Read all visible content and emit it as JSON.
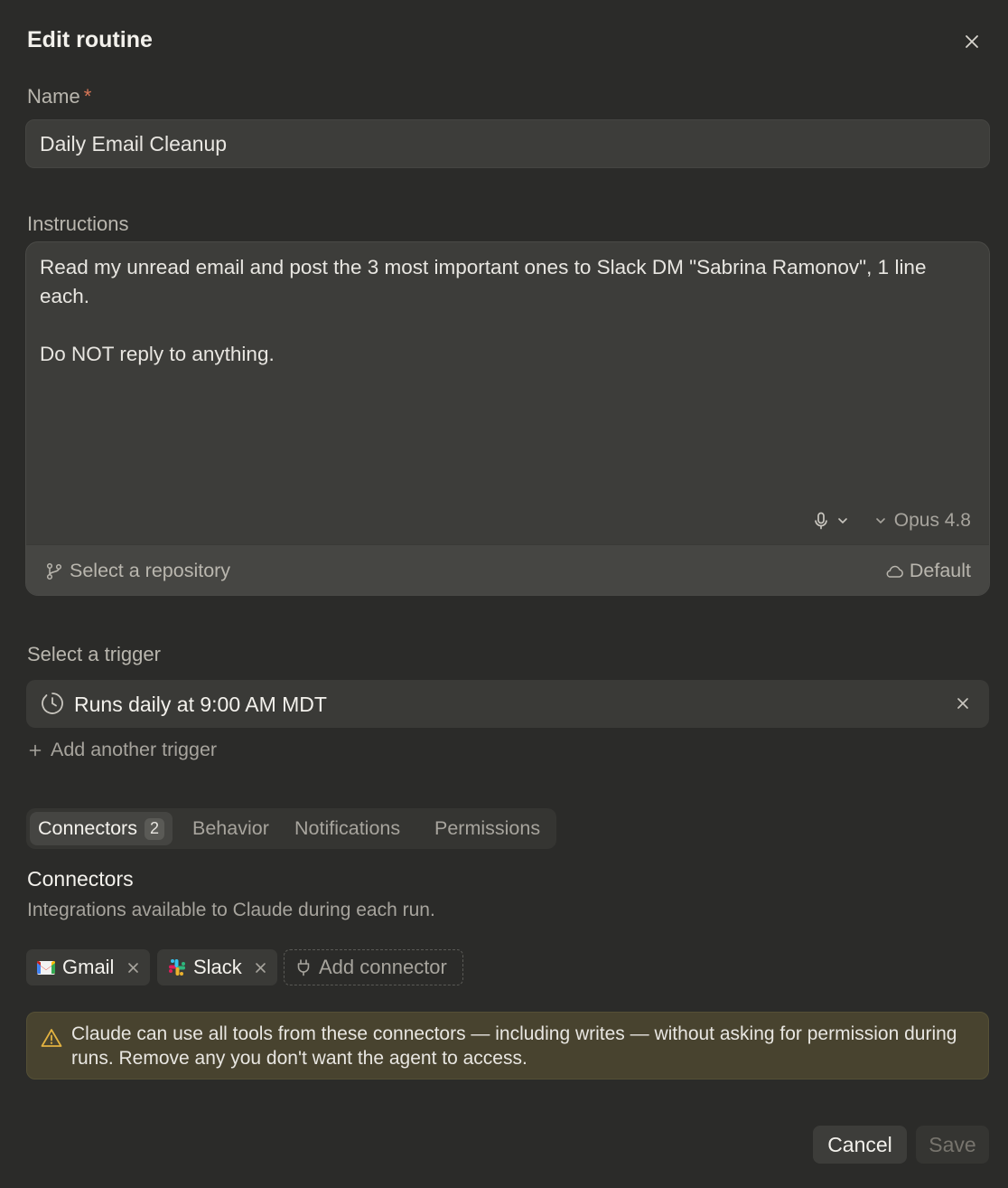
{
  "dialog": {
    "title": "Edit routine",
    "close_icon": "close-icon"
  },
  "name": {
    "label": "Name",
    "required_mark": "*",
    "value": "Daily Email Cleanup"
  },
  "instructions": {
    "label": "Instructions",
    "text": "Read my unread email and post the 3 most important ones to Slack DM \"Sabrina Ramonov\", 1 line each.\n\nDo NOT reply to anything.",
    "mic_icon": "microphone-icon",
    "model": "Opus 4.8",
    "repository_label": "Select a repository",
    "environment_label": "Default"
  },
  "trigger": {
    "label": "Select a trigger",
    "current": "Runs daily at 9:00 AM MDT",
    "add_label": "Add another trigger"
  },
  "tabs": [
    {
      "label": "Connectors",
      "badge": "2",
      "active": true
    },
    {
      "label": "Behavior",
      "active": false
    },
    {
      "label": "Notifications",
      "active": false
    },
    {
      "label": "Permissions",
      "active": false
    }
  ],
  "connectors": {
    "title": "Connectors",
    "description": "Integrations available to Claude during each run.",
    "items": [
      {
        "name": "Gmail",
        "icon": "gmail-icon"
      },
      {
        "name": "Slack",
        "icon": "slack-icon"
      }
    ],
    "add_label": "Add connector"
  },
  "warning": {
    "text": "Claude can use all tools from these connectors — including writes — without asking for permission during runs. Remove any you don't want the agent to access."
  },
  "actions": {
    "cancel": "Cancel",
    "save": "Save"
  },
  "colors": {
    "background": "#2b2b29",
    "required": "#d97757",
    "warning_bg": "#48432f",
    "warning_icon": "#e3b341"
  }
}
